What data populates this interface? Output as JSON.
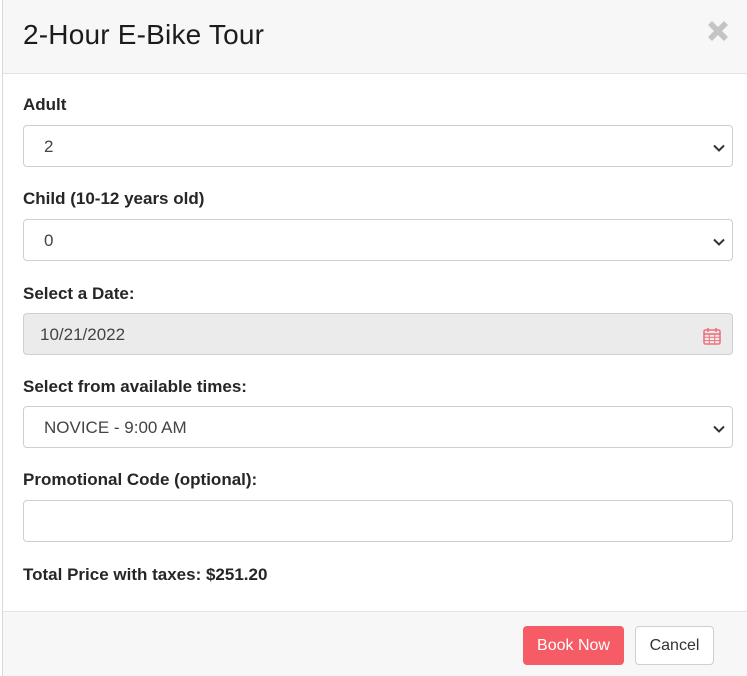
{
  "modal": {
    "title": "2-Hour E-Bike Tour"
  },
  "form": {
    "adult": {
      "label": "Adult",
      "value": "2"
    },
    "child": {
      "label": "Child (10-12 years old)",
      "value": "0"
    },
    "date": {
      "label": "Select a Date:",
      "value": "10/21/2022"
    },
    "time": {
      "label": "Select from available times:",
      "value": "NOVICE - 9:00 AM"
    },
    "promo": {
      "label": "Promotional Code (optional):",
      "value": "",
      "placeholder": ""
    }
  },
  "total": {
    "text": "Total Price with taxes: $251.20"
  },
  "footer": {
    "book_label": "Book Now",
    "cancel_label": "Cancel"
  },
  "colors": {
    "accent": "#f65c66",
    "header_bg": "#f7f7f7",
    "disabled_bg": "#ebebeb"
  },
  "icons": {
    "close": "close-icon",
    "dropdown": "chevron-down-icon",
    "calendar": "calendar-icon"
  }
}
